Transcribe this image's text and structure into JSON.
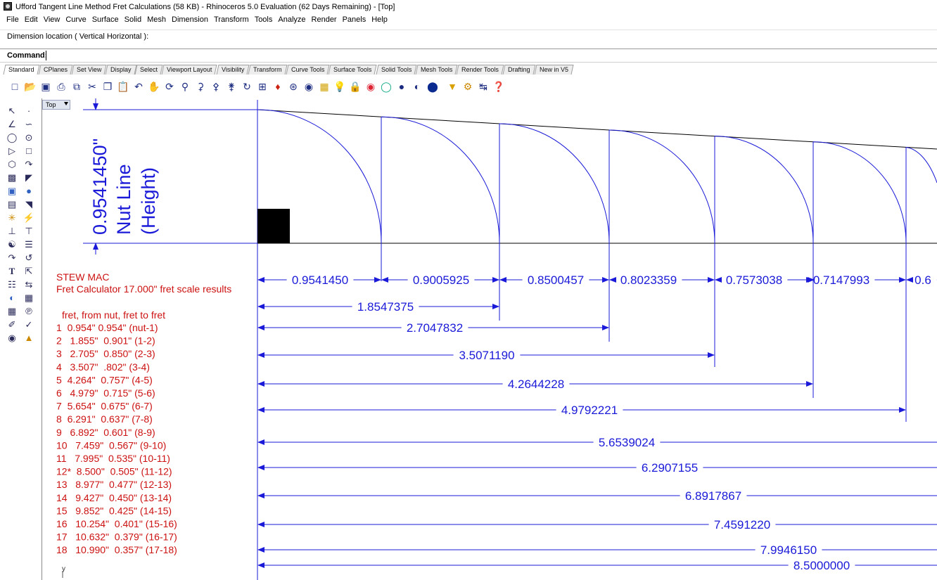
{
  "window": {
    "title": "Ufford Tangent Line Method Fret Calculations (58 KB) - Rhinoceros 5.0 Evaluation (62 Days Remaining) - [Top]"
  },
  "menu": [
    "File",
    "Edit",
    "View",
    "Curve",
    "Surface",
    "Solid",
    "Mesh",
    "Dimension",
    "Transform",
    "Tools",
    "Analyze",
    "Render",
    "Panels",
    "Help"
  ],
  "command": {
    "history": "Dimension location ( Vertical  Horizontal ):",
    "label": "Command:",
    "value": ""
  },
  "tabs": [
    "Standard",
    "CPlanes",
    "Set View",
    "Display",
    "Select",
    "Viewport Layout",
    "Visibility",
    "Transform",
    "Curve Tools",
    "Surface Tools",
    "Solid Tools",
    "Mesh Tools",
    "Render Tools",
    "Drafting",
    "New in V5"
  ],
  "active_tab": "Standard",
  "toolbar_icons": [
    "new-icon",
    "open-icon",
    "save-icon",
    "print-icon",
    "import-icon",
    "cut-icon",
    "copy-icon",
    "paste-icon",
    "undo-icon",
    "pan-icon",
    "rotate-icon",
    "zoom-icon",
    "zoom-window-icon",
    "zoom-extents-icon",
    "zoom-selected-icon",
    "rotate-view-icon",
    "four-viewports-icon",
    "car-icon",
    "osnap-icon",
    "point-icon",
    "layers-icon",
    "light-icon",
    "lock-icon",
    "material-icon",
    "render-icon",
    "sphere-icon",
    "env-icon",
    "ball-icon",
    "select-filter-icon",
    "options-icon",
    "dimension-icon",
    "help-icon"
  ],
  "viewport": {
    "name": "Top",
    "accent": "#1a1ad8",
    "note_color": "#cc1111"
  },
  "nut_dimension": {
    "value": "0.9541450\"",
    "line1": "Nut Line",
    "line2": "(Height)"
  },
  "notes": {
    "heading1": "STEW MAC",
    "heading2": "Fret Calculator 17.000\" fret scale results",
    "table_header": "fret,  from nut,  fret to fret",
    "rows": [
      "1  0.954\" 0.954\" (nut-1)",
      "2   1.855\"  0.901\" (1-2)",
      "3   2.705\"  0.850\" (2-3)",
      "4   3.507\"  .802\" (3-4)",
      "5  4.264\"  0.757\" (4-5)",
      "6   4.979\"  0.715\" (5-6)",
      "7  5.654\"  0.675\" (6-7)",
      "8  6.291\"  0.637\" (7-8)",
      "9   6.892\"  0.601\" (8-9)",
      "10   7.459\"  0.567\" (9-10)",
      "11   7.995\"  0.535\" (10-11)",
      "12*  8.500\"  0.505\" (11-12)",
      "13   8.977\"  0.477\" (12-13)",
      "14   9.427\"  0.450\" (13-14)",
      "15   9.852\"  0.425\" (14-15)",
      "16   10.254\"  0.401\" (15-16)",
      "17   10.632\"  0.379\" (16-17)",
      "18   10.990\"  0.357\" (17-18)"
    ]
  },
  "segment_dims": [
    "0.9541450",
    "0.9005925",
    "0.8500457",
    "0.8023359",
    "0.7573038",
    "0.7147993",
    "0.6"
  ],
  "cumulative_dims": [
    "1.8547375",
    "2.7047832",
    "3.5071190",
    "4.2644228",
    "4.9792221",
    "5.6539024",
    "6.2907155",
    "6.8917867",
    "7.4591220",
    "7.9946150",
    "8.5000000"
  ]
}
